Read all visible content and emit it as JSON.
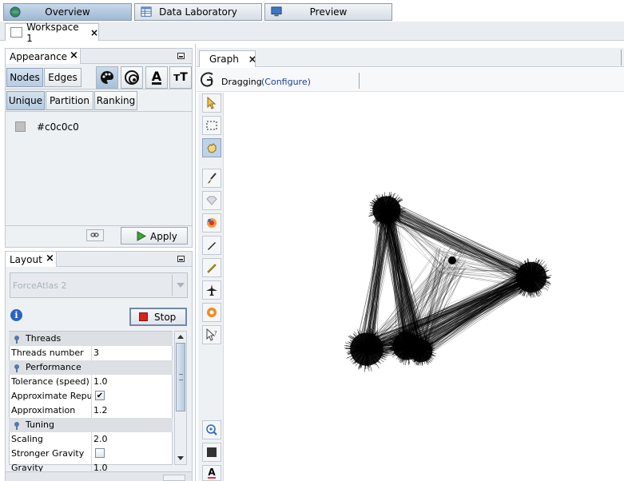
{
  "top_buttons": {
    "overview": "Overview",
    "data_laboratory": "Data Laboratory",
    "preview": "Preview"
  },
  "workspace_tab": {
    "label": "Workspace 1",
    "close": "×"
  },
  "appearance": {
    "title": "Appearance",
    "close": "×",
    "nodes_tab": "Nodes",
    "edges_tab": "Edges",
    "font_icon_text": "A",
    "size_icon_text": "тT",
    "unique_tab": "Unique",
    "partition_tab": "Partition",
    "ranking_tab": "Ranking",
    "color_value": "#c0c0c0",
    "apply_label": "Apply"
  },
  "layout": {
    "title": "Layout",
    "close": "×",
    "algorithm": "ForceAtlas 2",
    "info_icon_text": "i",
    "stop_label": "Stop",
    "properties": [
      {
        "type": "category",
        "label": "Threads"
      },
      {
        "type": "row",
        "label": "Threads number",
        "value": "3"
      },
      {
        "type": "category",
        "label": "Performance"
      },
      {
        "type": "row",
        "label": "Tolerance (speed)",
        "value": "1.0"
      },
      {
        "type": "row",
        "label": "Approximate Repulsion",
        "value": "✔",
        "checkbox": true
      },
      {
        "type": "row",
        "label": "Approximation",
        "value": "1.2"
      },
      {
        "type": "category",
        "label": "Tuning"
      },
      {
        "type": "row",
        "label": "Scaling",
        "value": "2.0"
      },
      {
        "type": "row",
        "label": "Stronger Gravity",
        "value": "",
        "checkbox": true
      },
      {
        "type": "row",
        "label": "Gravity",
        "value": "1.0"
      }
    ]
  },
  "graph": {
    "tab_label": "Graph",
    "close": "×",
    "mode_text": "Dragging",
    "configure_link": "(Configure)",
    "font_tool_text": "A"
  },
  "colors": {
    "selection_blue": "#bfd3e8",
    "link_blue": "#1a3fa0",
    "node_color": "#c0c0c0",
    "stop_red": "#d8231c"
  }
}
